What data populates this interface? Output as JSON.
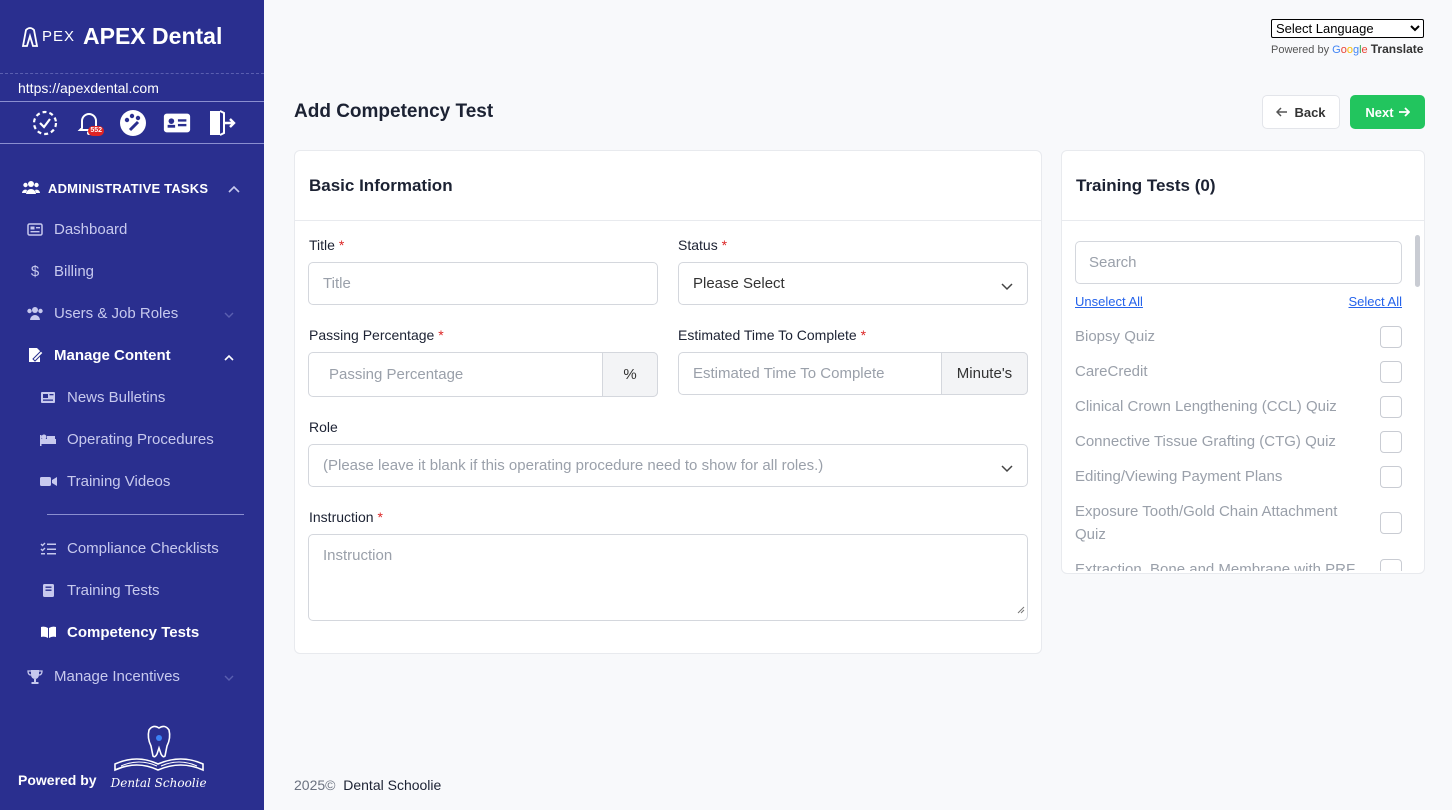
{
  "brand": {
    "logo_text": "PEX",
    "name": "APEX Dental",
    "url": "https://apexdental.com"
  },
  "notifications": {
    "count": "552"
  },
  "sidebar": {
    "section_label": "ADMINISTRATIVE TASKS",
    "items": [
      {
        "label": "Dashboard",
        "icon": "dashboard-icon"
      },
      {
        "label": "Billing",
        "icon": "dollar-icon"
      },
      {
        "label": "Users & Job Roles",
        "icon": "users-icon"
      },
      {
        "label": "Manage Content",
        "icon": "content-icon"
      },
      {
        "label": "News Bulletins",
        "icon": "newspaper-icon"
      },
      {
        "label": "Operating Procedures",
        "icon": "procedure-icon"
      },
      {
        "label": "Training Videos",
        "icon": "video-icon"
      },
      {
        "label": "Compliance Checklists",
        "icon": "checklist-icon"
      },
      {
        "label": "Training Tests",
        "icon": "book-icon"
      },
      {
        "label": "Competency Tests",
        "icon": "open-book-icon"
      },
      {
        "label": "Manage Incentives",
        "icon": "trophy-icon"
      }
    ],
    "powered_by": "Powered by",
    "powered_logo_text": "Dental Schoolie"
  },
  "translate": {
    "select_label": "Select Language",
    "powered": "Powered by",
    "google": "Google",
    "translate": "Translate"
  },
  "page": {
    "title": "Add Competency Test",
    "back_label": "Back",
    "next_label": "Next"
  },
  "form": {
    "heading": "Basic Information",
    "title_label": "Title",
    "title_placeholder": "Title",
    "status_label": "Status",
    "status_value": "Please Select",
    "passing_label": "Passing Percentage",
    "passing_placeholder": "Passing Percentage",
    "passing_unit": "%",
    "time_label": "Estimated Time To Complete",
    "time_placeholder": "Estimated Time To Complete",
    "time_unit": "Minute's",
    "role_label": "Role",
    "role_placeholder": "(Please leave it blank if this operating procedure need to show for all roles.)",
    "instruction_label": "Instruction",
    "instruction_placeholder": "Instruction",
    "required_mark": "*"
  },
  "training_tests": {
    "heading": "Training Tests (0)",
    "search_placeholder": "Search",
    "unselect_all": "Unselect All",
    "select_all": "Select All",
    "items": [
      "Biopsy Quiz",
      "CareCredit",
      "Clinical Crown Lengthening (CCL) Quiz",
      "Connective Tissue Grafting (CTG) Quiz",
      "Editing/Viewing Payment Plans",
      "Exposure Tooth/Gold Chain Attachment Quiz",
      "Extraction, Bone and Membrane with PRF"
    ]
  },
  "footer": {
    "year": "2025©",
    "company": "Dental Schoolie"
  }
}
